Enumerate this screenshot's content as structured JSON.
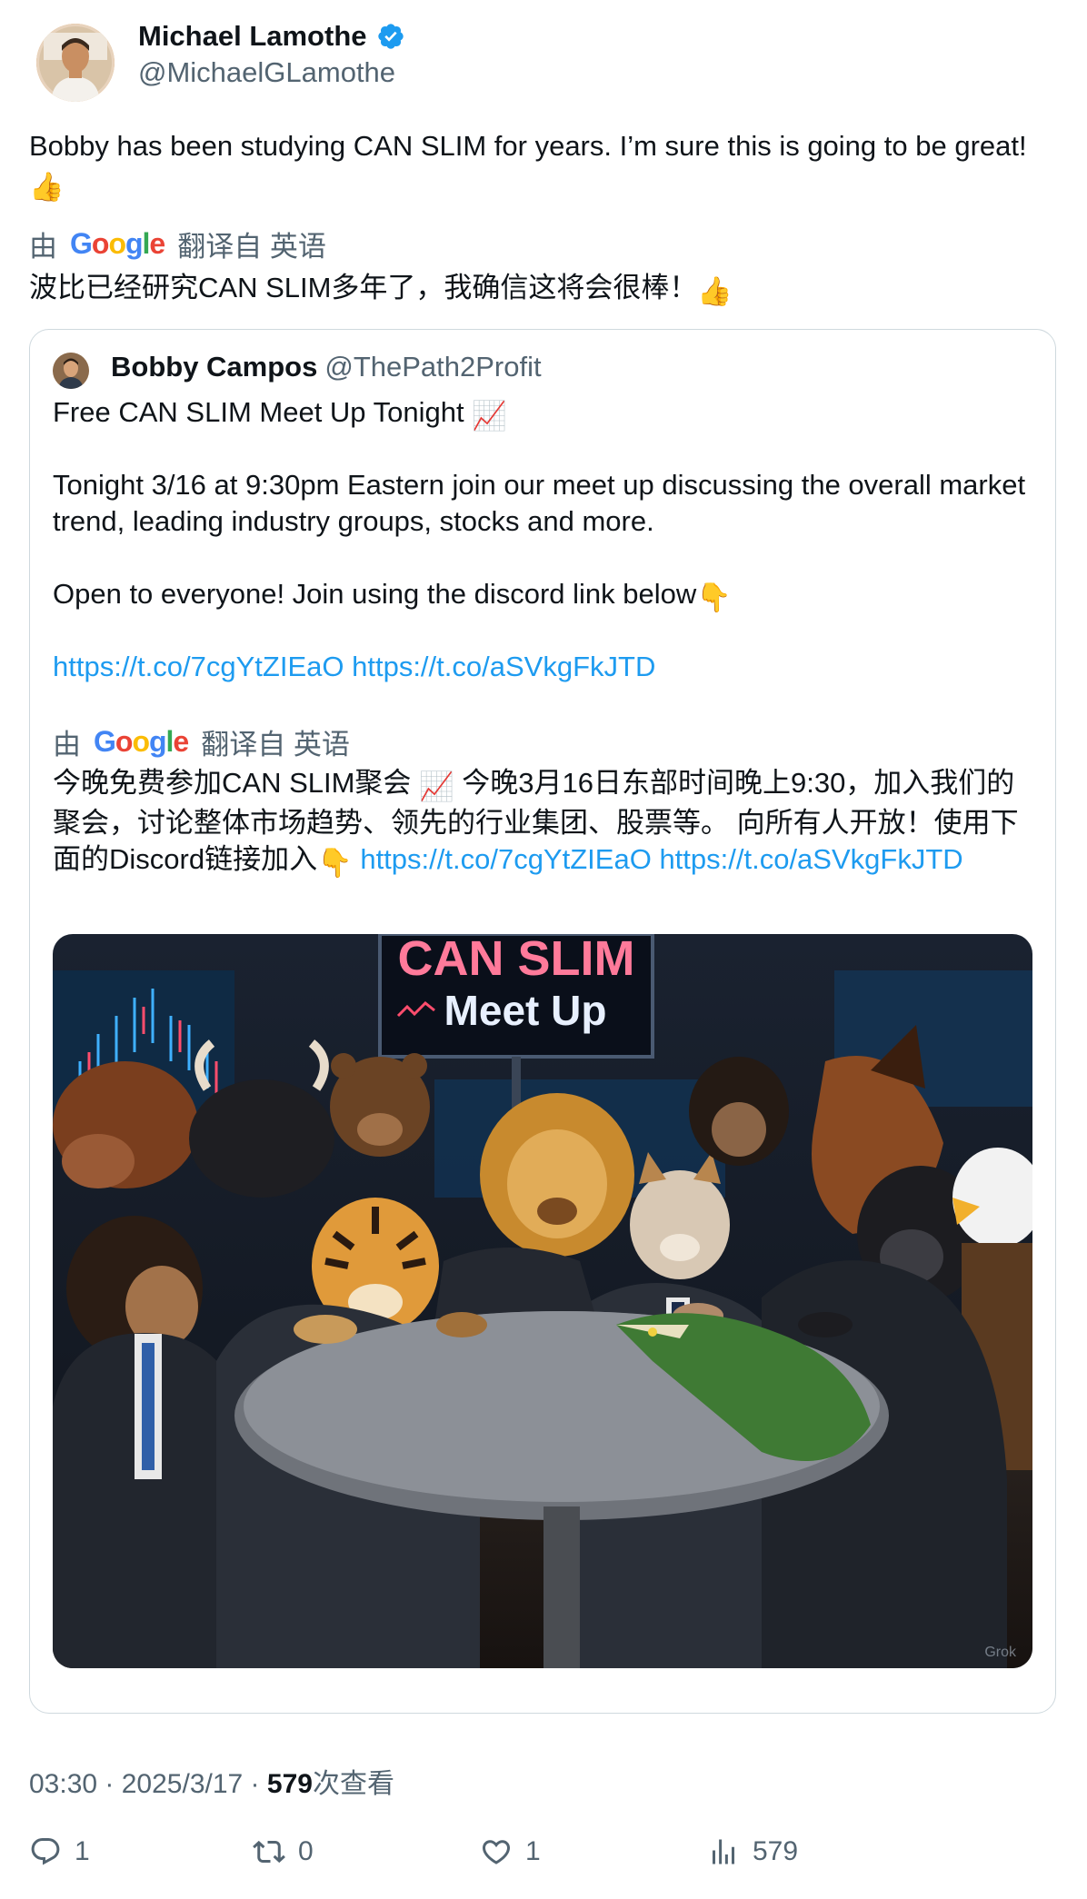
{
  "author": {
    "name": "Michael Lamothe",
    "handle": "@MichaelGLamothe",
    "verified": true
  },
  "tweet": {
    "text": "Bobby has been studying CAN SLIM for years. I’m sure this is going to be great! ",
    "emoji": "👍"
  },
  "translation_bar": {
    "prefix": "由",
    "brand": "Google",
    "suffix": "翻译自 英语"
  },
  "tweet_translation": {
    "text": "波比已经研究CAN SLIM多年了，我确信这将会很棒！",
    "emoji": "👍"
  },
  "quote": {
    "name": "Bobby Campos",
    "handle": "@ThePath2Profit",
    "line1": "Free CAN SLIM Meet Up Tonight ",
    "line1_emoji": "📈",
    "paragraph2": "Tonight 3/16 at 9:30pm Eastern join our meet up discussing the overall market trend, leading industry groups, stocks and more.",
    "paragraph3": "Open to everyone! Join using the discord link below",
    "paragraph3_emoji": "👇",
    "link1": "https://t.co/7cgYtZIEaO",
    "link2": "https://t.co/aSVkgFkJTD",
    "translation": {
      "part1": "今晚免费参加CAN SLIM聚会 ",
      "emoji1": "📈",
      "part2": " 今晚3月16日东部时间晚上9:30，加入我们的聚会，讨论整体市场趋势、领先的行业集团、股票等。 向所有人开放！使用下面的Discord链接加入",
      "emoji2": "👇",
      "link1": "https://t.co/7cgYtZIEaO",
      "link2": "https://t.co/aSVkgFkJTD"
    },
    "image": {
      "screen_line1": "CAN SLIM",
      "screen_line2": "Meet Up",
      "watermark": "Grok"
    }
  },
  "meta": {
    "time": "03:30",
    "sep1": " · ",
    "date": "2025/3/17",
    "sep2": " · ",
    "views": "579",
    "views_label": "次查看"
  },
  "actions": {
    "replies": "1",
    "retweets": "0",
    "likes": "1",
    "views": "579"
  },
  "colors": {
    "link": "#1d9bf0",
    "secondary": "#536471",
    "verified": "#1d9bf0"
  }
}
